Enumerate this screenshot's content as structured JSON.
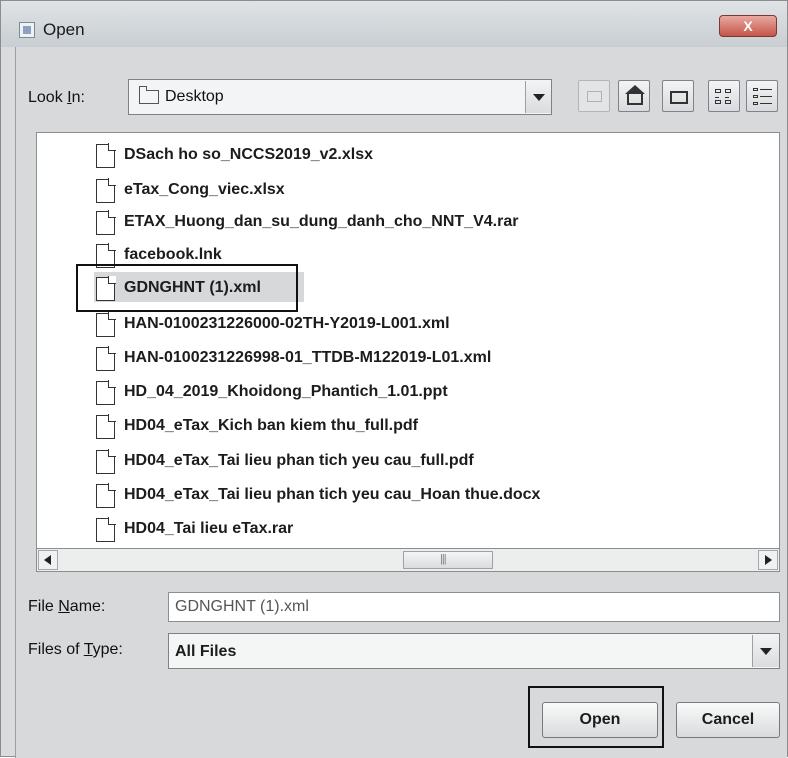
{
  "window": {
    "title": "Open",
    "close_label": "X"
  },
  "look_in": {
    "label_prefix": "Look ",
    "label_underlined": "I",
    "label_suffix": "n:",
    "value": "Desktop"
  },
  "files": [
    "DSach ho so_NCCS2019_v2.xlsx",
    "eTax_Cong_viec.xlsx",
    "ETAX_Huong_dan_su_dung_danh_cho_NNT_V4.rar",
    "facebook.lnk",
    "GDNGHNT (1).xml",
    "HAN-0100231226000-02TH-Y2019-L001.xml",
    "HAN-0100231226998-01_TTDB-M122019-L01.xml",
    "HD_04_2019_Khoidong_Phantich_1.01.ppt",
    "HD04_eTax_Kich ban kiem thu_full.pdf",
    "HD04_eTax_Tai lieu phan tich yeu cau_full.pdf",
    "HD04_eTax_Tai lieu phan tich yeu cau_Hoan thue.docx",
    "HD04_Tai lieu eTax.rar"
  ],
  "selected_file": "GDNGHNT (1).xml",
  "file_name": {
    "label_prefix": "File ",
    "label_underlined": "N",
    "label_suffix": "ame:",
    "value": "GDNGHNT (1).xml"
  },
  "file_type": {
    "label_prefix": "Files of ",
    "label_underlined": "T",
    "label_suffix": "ype:",
    "value": "All Files"
  },
  "buttons": {
    "open": "Open",
    "cancel": "Cancel"
  }
}
